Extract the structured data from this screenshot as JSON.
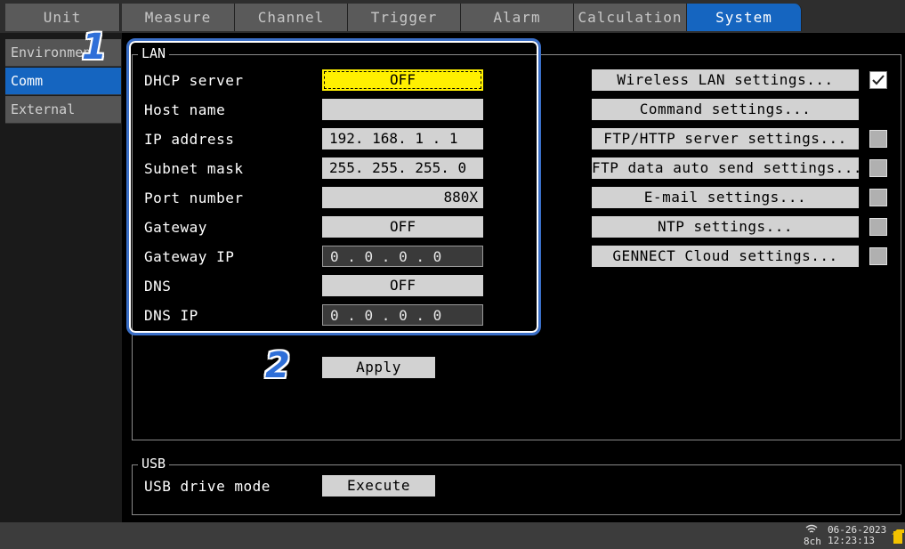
{
  "tabs": [
    {
      "label": "Unit"
    },
    {
      "label": "Measure"
    },
    {
      "label": "Channel"
    },
    {
      "label": "Trigger"
    },
    {
      "label": "Alarm"
    },
    {
      "label": "Calculation"
    },
    {
      "label": "System"
    }
  ],
  "sidebar": {
    "items": [
      {
        "label": "Environment"
      },
      {
        "label": "Comm"
      },
      {
        "label": "External"
      }
    ]
  },
  "lan": {
    "title": "LAN",
    "rows": [
      {
        "label": "DHCP server",
        "value": "OFF"
      },
      {
        "label": "Host name",
        "value": ""
      },
      {
        "label": "IP address",
        "value": "192. 168. 1   . 1"
      },
      {
        "label": "Subnet mask",
        "value": "255. 255. 255. 0"
      },
      {
        "label": "Port number",
        "value": "880X"
      },
      {
        "label": "Gateway",
        "value": "OFF"
      },
      {
        "label": "Gateway IP",
        "value": "0   . 0   . 0   . 0"
      },
      {
        "label": "DNS",
        "value": "OFF"
      },
      {
        "label": "DNS IP",
        "value": "0   . 0   . 0   . 0"
      }
    ]
  },
  "settings_buttons": [
    {
      "label": "Wireless LAN settings...",
      "checked": true
    },
    {
      "label": "Command settings..."
    },
    {
      "label": "FTP/HTTP server settings...",
      "checked": false
    },
    {
      "label": "FTP data auto send settings...",
      "checked": false
    },
    {
      "label": "E-mail settings...",
      "checked": false
    },
    {
      "label": "NTP settings...",
      "checked": false
    },
    {
      "label": "GENNECT Cloud settings...",
      "checked": false
    }
  ],
  "apply_label": "Apply",
  "usb": {
    "title": "USB",
    "row_label": "USB drive mode",
    "button_label": "Execute"
  },
  "callouts": {
    "one": "1",
    "two": "2"
  },
  "status": {
    "channels": "8ch",
    "date": "06-26-2023",
    "time": "12:23:13"
  },
  "colors": {
    "accent": "#1565c0",
    "highlight_field": "#fff000",
    "callout": "#2f6fd8"
  }
}
